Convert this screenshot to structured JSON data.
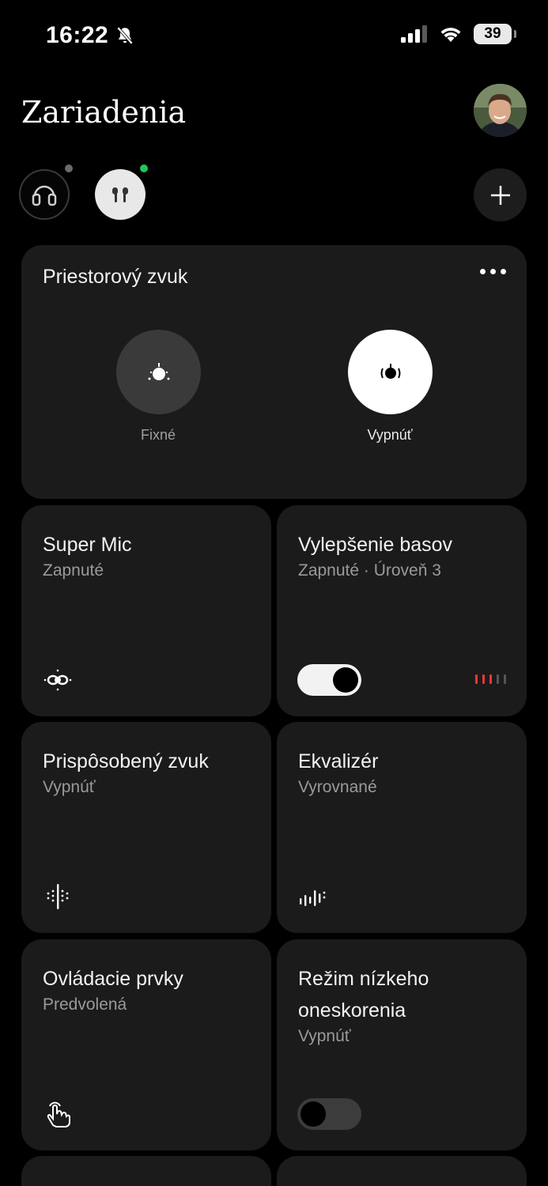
{
  "status": {
    "time": "16:22",
    "battery": "39"
  },
  "header": {
    "title": "Zariadenia"
  },
  "spatial": {
    "title": "Priestorový zvuk",
    "modes": [
      {
        "label": "Fixné",
        "selected": false
      },
      {
        "label": "Vypnúť",
        "selected": true
      }
    ]
  },
  "cards": {
    "super_mic": {
      "title": "Super Mic",
      "subtitle": "Zapnuté"
    },
    "bass": {
      "title": "Vylepšenie basov",
      "subtitle": "Zapnuté · Úroveň 3",
      "toggle_on": true,
      "level": 3,
      "level_max": 5
    },
    "adaptive": {
      "title": "Prispôsobený zvuk",
      "subtitle": "Vypnúť"
    },
    "eq": {
      "title": "Ekvalizér",
      "subtitle": "Vyrovnané"
    },
    "controls": {
      "title": "Ovládacie prvky",
      "subtitle": "Predvolená"
    },
    "low_latency": {
      "title_line1": "Režim nízkeho",
      "title_line2": "oneskorenia",
      "subtitle": "Vypnúť",
      "toggle_on": false
    }
  },
  "colors": {
    "accent_active": "#e53935",
    "connected_dot": "#22c55e"
  }
}
